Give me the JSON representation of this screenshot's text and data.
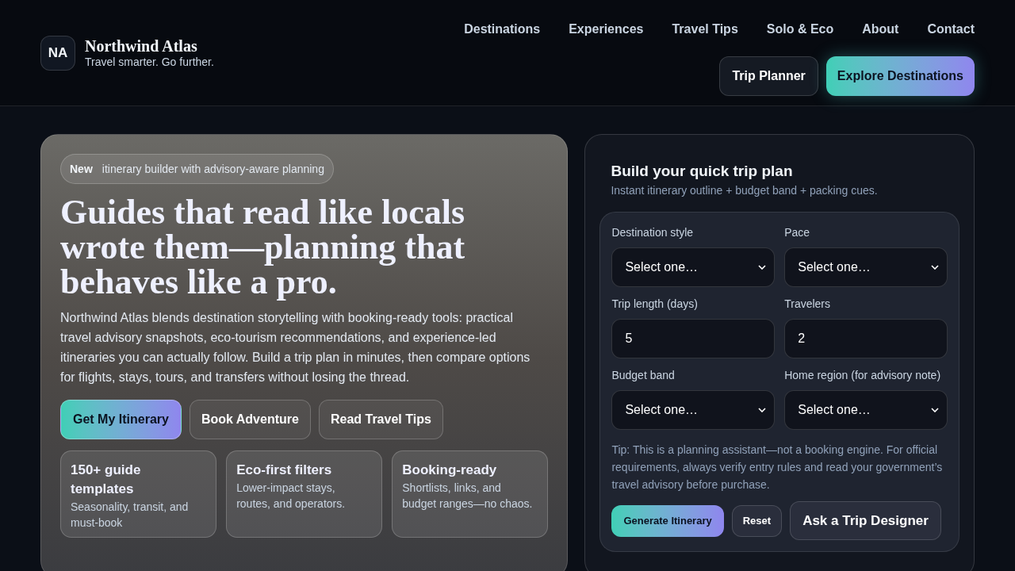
{
  "brand": {
    "monogram": "NA",
    "name": "Northwind Atlas",
    "tagline": "Travel smarter. Go further."
  },
  "nav": [
    "Destinations",
    "Experiences",
    "Travel Tips",
    "Solo & Eco",
    "About",
    "Contact"
  ],
  "header_buttons": [
    {
      "label": "Trip Planner",
      "kind": "secondary"
    },
    {
      "label": "Explore Destinations",
      "kind": "primary"
    }
  ],
  "hero": {
    "badge": {
      "tag": "New",
      "text": "itinerary builder with advisory-aware planning"
    },
    "heading": "Guides that read like locals wrote them—planning that behaves like a pro.",
    "description": "Northwind Atlas blends destination storytelling with booking-ready tools: practical travel advisory snapshots, eco-tourism recommendations, and experience-led itineraries you can actually follow. Build a trip plan in minutes, then compare options for flights, stays, tours, and transfers without losing the thread.",
    "buttons": [
      {
        "label": "Get My Itinerary",
        "kind": "primary"
      },
      {
        "label": "Book Adventure",
        "kind": "ghost"
      },
      {
        "label": "Read Travel Tips",
        "kind": "ghost"
      }
    ],
    "features": [
      {
        "title": "150+ guide templates",
        "text": "Seasonality, transit, and must-book"
      },
      {
        "title": "Eco-first filters",
        "text": "Lower-impact stays, routes, and operators."
      },
      {
        "title": "Booking-ready",
        "text": "Shortlists, links, and budget ranges—no chaos."
      }
    ]
  },
  "planner": {
    "title": "Build your quick trip plan",
    "subtitle": "Instant itinerary outline + budget band + packing cues.",
    "fields": [
      {
        "label": "Destination style",
        "kind": "select",
        "value": "Select one…"
      },
      {
        "label": "Pace",
        "kind": "select",
        "value": "Select one…"
      },
      {
        "label": "Trip length (days)",
        "kind": "input",
        "value": "5"
      },
      {
        "label": "Travelers",
        "kind": "input",
        "value": "2"
      },
      {
        "label": "Budget band",
        "kind": "select",
        "value": "Select one…"
      },
      {
        "label": "Home region (for advisory note)",
        "kind": "select",
        "value": "Select one…"
      }
    ],
    "tip": "Tip: This is a planning assistant—not a booking engine. For official requirements, always verify entry rules and read your government’s travel advisory before purchase.",
    "buttons": [
      {
        "label": "Generate Itinerary",
        "kind": "primary"
      },
      {
        "label": "Reset",
        "kind": "secondary"
      },
      {
        "label": "Ask a Trip Designer",
        "kind": "large"
      }
    ]
  }
}
